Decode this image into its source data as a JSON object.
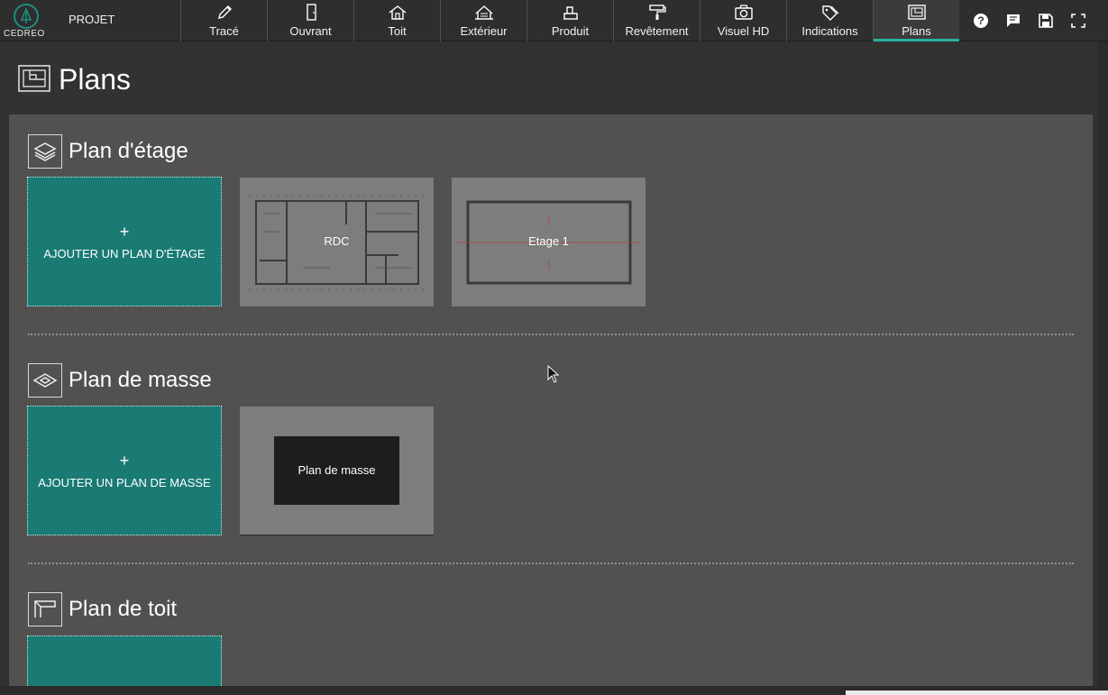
{
  "app": {
    "logo_text": "CEDREO",
    "project_label": "PROJET"
  },
  "nav": {
    "items": [
      {
        "label": "Tracé",
        "icon": "pencil-icon"
      },
      {
        "label": "Ouvrant",
        "icon": "door-icon"
      },
      {
        "label": "Toit",
        "icon": "roof-icon"
      },
      {
        "label": "Extérieur",
        "icon": "exterior-icon"
      },
      {
        "label": "Produit",
        "icon": "product-icon"
      },
      {
        "label": "Revêtement",
        "icon": "paint-roller-icon"
      },
      {
        "label": "Visuel HD",
        "icon": "camera-icon"
      },
      {
        "label": "Indications",
        "icon": "tags-icon"
      },
      {
        "label": "Plans",
        "icon": "plans-icon"
      }
    ],
    "active": "Plans"
  },
  "tools": [
    {
      "icon": "help-icon"
    },
    {
      "icon": "comment-icon"
    },
    {
      "icon": "save-icon"
    },
    {
      "icon": "fullscreen-icon"
    }
  ],
  "page": {
    "title": "Plans"
  },
  "sections": {
    "floor": {
      "title": "Plan d'étage",
      "add_plus": "+",
      "add_label": "AJOUTER UN PLAN D'ÉTAGE",
      "plans": [
        {
          "label": "RDC"
        },
        {
          "label": "Etage 1"
        }
      ]
    },
    "site": {
      "title": "Plan de masse",
      "add_plus": "+",
      "add_label": "AJOUTER UN PLAN DE MASSE",
      "plans": [
        {
          "label": "Plan de masse"
        }
      ]
    },
    "roof": {
      "title": "Plan de toit"
    }
  },
  "colors": {
    "accent": "#2ab0a2",
    "add_card": "#1a7a74",
    "panel": "#535150",
    "thumb": "#7d7d7d"
  }
}
